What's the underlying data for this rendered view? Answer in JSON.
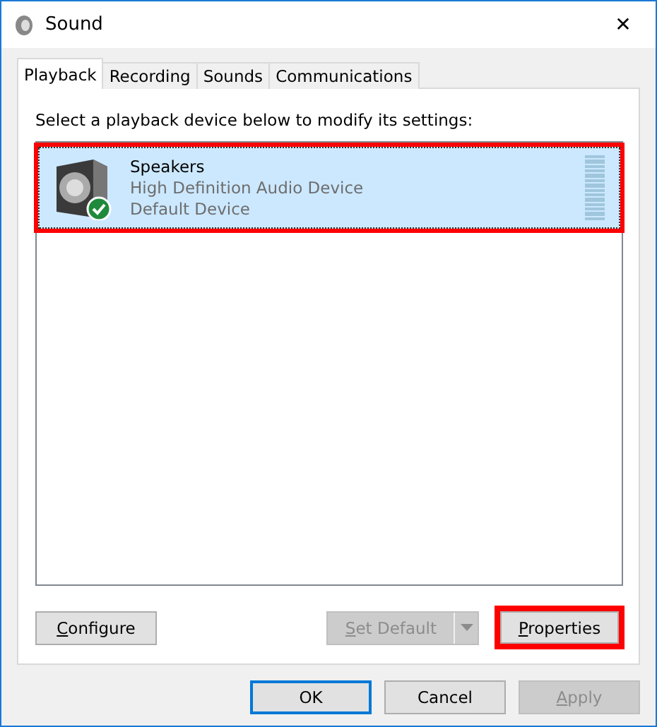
{
  "window": {
    "title": "Sound",
    "close": "✕"
  },
  "tabs": [
    {
      "label": "Playback",
      "selected": true
    },
    {
      "label": "Recording",
      "selected": false
    },
    {
      "label": "Sounds",
      "selected": false
    },
    {
      "label": "Communications",
      "selected": false
    }
  ],
  "instruction": "Select a playback device below to modify its settings:",
  "devices": [
    {
      "name": "Speakers",
      "description": "High Definition Audio Device",
      "status": "Default Device",
      "selected": true,
      "default": true,
      "highlighted": true
    }
  ],
  "panel_buttons": [
    {
      "label": "Configure",
      "disabled": false,
      "kind": "plain"
    },
    {
      "label": "Set Default",
      "disabled": true,
      "kind": "split"
    },
    {
      "label": "Properties",
      "disabled": false,
      "highlighted": true,
      "kind": "plain"
    }
  ],
  "dialog_buttons": [
    {
      "label": "OK",
      "disabled": false,
      "default": true,
      "mnemonic": false
    },
    {
      "label": "Cancel",
      "disabled": false,
      "default": false,
      "mnemonic": false
    },
    {
      "label": "Apply",
      "disabled": true,
      "default": false,
      "mnemonic": true
    }
  ]
}
